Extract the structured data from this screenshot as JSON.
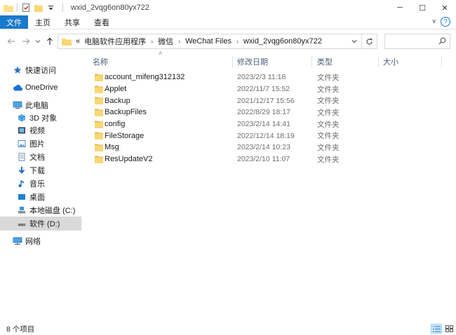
{
  "window": {
    "title": "wxid_2vqg6on80yx722",
    "minimize": "─",
    "maximize": "☐",
    "close": "✕"
  },
  "ribbon": {
    "tabs": [
      "文件",
      "主页",
      "共享",
      "查看"
    ],
    "help": "?"
  },
  "address": {
    "overflow": "«",
    "crumbs": [
      "电脑软件应用程序",
      "微信",
      "WeChat Files",
      "wxid_2vqg6on80yx722"
    ],
    "separator": "›",
    "search_placeholder": ""
  },
  "sidebar": {
    "items": [
      {
        "label": "快速访问",
        "icon": "star-icon"
      },
      {
        "label": "OneDrive",
        "icon": "cloud-icon"
      },
      {
        "label": "此电脑",
        "icon": "computer-icon"
      },
      {
        "label": "3D 对象",
        "icon": "cube-icon"
      },
      {
        "label": "视频",
        "icon": "video-icon"
      },
      {
        "label": "图片",
        "icon": "pictures-icon"
      },
      {
        "label": "文档",
        "icon": "documents-icon"
      },
      {
        "label": "下载",
        "icon": "download-icon"
      },
      {
        "label": "音乐",
        "icon": "music-icon"
      },
      {
        "label": "桌面",
        "icon": "desktop-icon"
      },
      {
        "label": "本地磁盘 (C:)",
        "icon": "drive-icon"
      },
      {
        "label": "软件 (D:)",
        "icon": "drive-icon",
        "selected": true
      },
      {
        "label": "网络",
        "icon": "network-icon"
      }
    ]
  },
  "columns": {
    "name": "名称",
    "modified": "修改日期",
    "type": "类型",
    "size": "大小"
  },
  "files": [
    {
      "name": "account_mifeng312132",
      "modified": "2023/2/3 11:18",
      "type": "文件夹"
    },
    {
      "name": "Applet",
      "modified": "2022/11/7 15:52",
      "type": "文件夹"
    },
    {
      "name": "Backup",
      "modified": "2021/12/17 15:56",
      "type": "文件夹"
    },
    {
      "name": "BackupFiles",
      "modified": "2022/8/29 18:17",
      "type": "文件夹"
    },
    {
      "name": "config",
      "modified": "2023/2/14 14:41",
      "type": "文件夹"
    },
    {
      "name": "FileStorage",
      "modified": "2022/12/14 18:19",
      "type": "文件夹"
    },
    {
      "name": "Msg",
      "modified": "2023/2/14 10:23",
      "type": "文件夹"
    },
    {
      "name": "ResUpdateV2",
      "modified": "2023/2/10 11:07",
      "type": "文件夹"
    }
  ],
  "status": {
    "count": "8 个项目"
  },
  "colors": {
    "accent": "#1979ca",
    "folder": "#f8d775",
    "folder_dark": "#e6b94a",
    "selected_bg": "#d9d9d9"
  }
}
